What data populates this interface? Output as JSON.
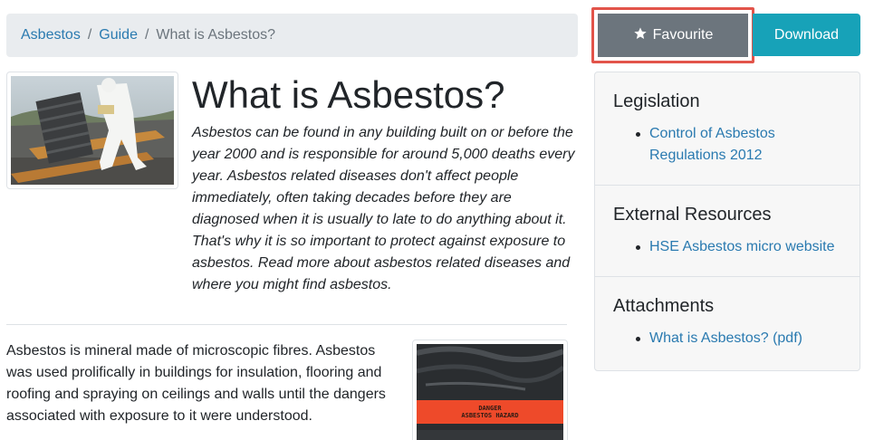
{
  "breadcrumb": {
    "items": [
      {
        "label": "Asbestos"
      },
      {
        "label": "Guide"
      }
    ],
    "separator": "/",
    "current": "What is Asbestos?"
  },
  "actions": {
    "favourite_label": "Favourite",
    "download_label": "Download"
  },
  "article": {
    "title": "What is Asbestos?",
    "lead": "Asbestos can be found in any building built on or before the year 2000 and is responsible for around 5,000 deaths every year. Asbestos related diseases don't affect people immediately, often taking decades before they are diagnosed when it is usually to late to do anything about it. That's why it is so important to protect against exposure to asbestos. Read more about asbestos related diseases and where you might find asbestos.",
    "body": "Asbestos is mineral made of microscopic fibres. Asbestos was used prolifically in buildings for insulation, flooring and roofing and spraying on ceilings and walls until the dangers associated with exposure to it were understood.",
    "bag_label_line1": "DANGER",
    "bag_label_line2": "ASBESTOS HAZARD"
  },
  "sidebar": {
    "legislation": {
      "heading": "Legislation",
      "links": [
        "Control of Asbestos Regulations 2012"
      ]
    },
    "external": {
      "heading": "External Resources",
      "links": [
        "HSE Asbestos micro website"
      ]
    },
    "attachments": {
      "heading": "Attachments",
      "links": [
        "What is Asbestos? (pdf)"
      ]
    }
  },
  "colors": {
    "link": "#2a7ab0",
    "favourite_bg": "#6c757d",
    "download_bg": "#17a2b8",
    "highlight_border": "#e2544a"
  },
  "icons": {
    "favourite": "star-icon"
  }
}
